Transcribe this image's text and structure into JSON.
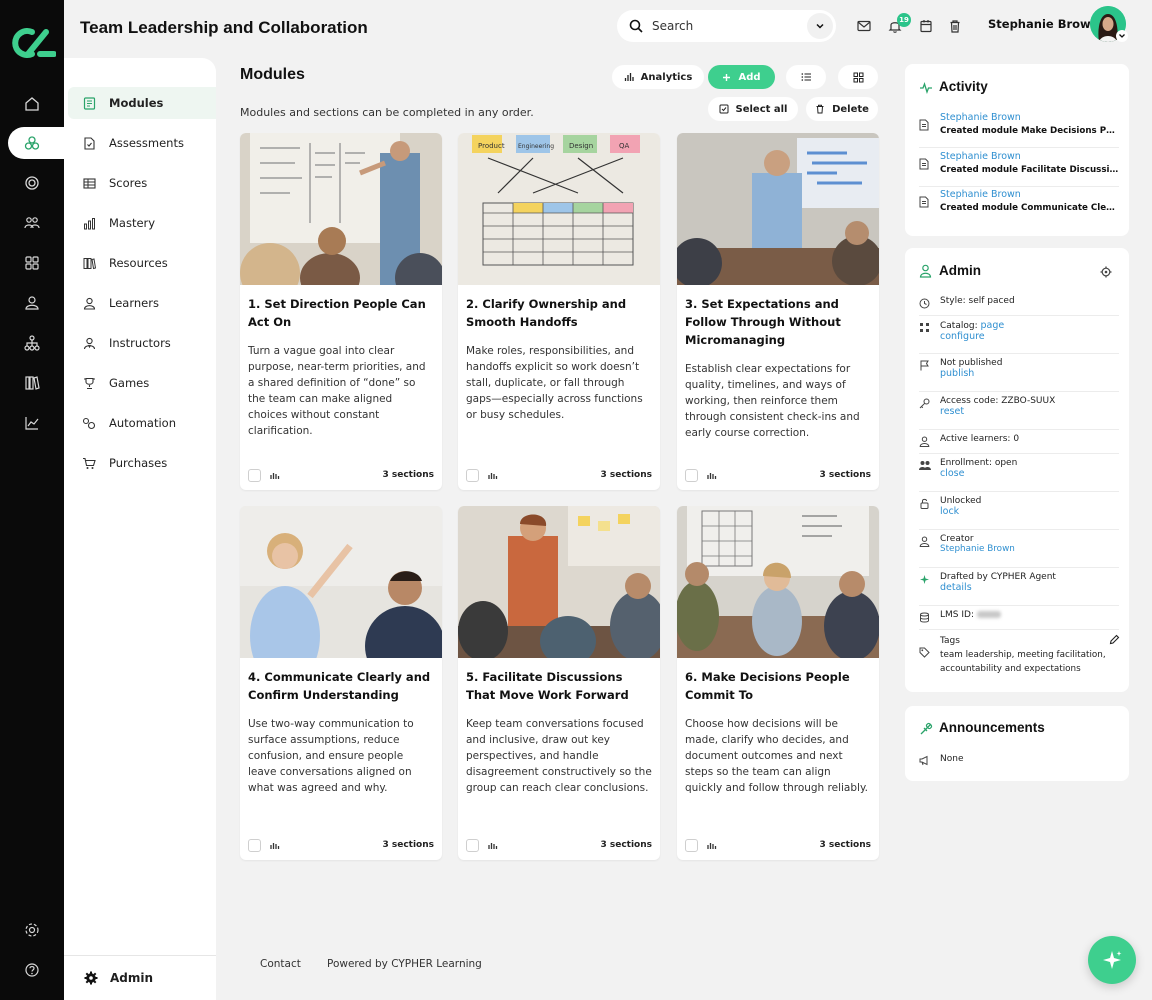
{
  "app": {
    "title": "Team Leadership and Collaboration"
  },
  "header": {
    "search_label": "Search",
    "notification_count": "19",
    "user_name": "Stephanie Brown"
  },
  "submenu": {
    "items": [
      {
        "label": "Modules",
        "icon": "modules-icon"
      },
      {
        "label": "Assessments",
        "icon": "assessments-icon"
      },
      {
        "label": "Scores",
        "icon": "scores-icon"
      },
      {
        "label": "Mastery",
        "icon": "mastery-icon"
      },
      {
        "label": "Resources",
        "icon": "resources-icon"
      },
      {
        "label": "Learners",
        "icon": "learners-icon"
      },
      {
        "label": "Instructors",
        "icon": "instructors-icon"
      },
      {
        "label": "Games",
        "icon": "games-icon"
      },
      {
        "label": "Automation",
        "icon": "automation-icon"
      },
      {
        "label": "Purchases",
        "icon": "purchases-icon"
      }
    ],
    "admin_label": "Admin"
  },
  "modules": {
    "title": "Modules",
    "subtitle": "Modules and sections can be completed in any order.",
    "analytics_label": "Analytics",
    "add_label": "Add",
    "select_all_label": "Select all",
    "delete_label": "Delete"
  },
  "cards": [
    {
      "title": "1. Set Direction People Can Act On",
      "desc": "Turn a vague goal into clear purpose, near-term priorities, and a shared definition of “done” so the team can make aligned choices without constant clarification.",
      "sections": "3 sections"
    },
    {
      "title": "2. Clarify Ownership and Smooth Handoffs",
      "desc": "Make roles, responsibilities, and handoffs explicit so work doesn’t stall, duplicate, or fall through gaps—especially across functions or busy schedules.",
      "sections": "3 sections",
      "sticky": [
        "Product",
        "Engineering",
        "Design",
        "QA"
      ]
    },
    {
      "title": "3. Set Expectations and Follow Through Without Micromanaging",
      "desc": "Establish clear expectations for quality, timelines, and ways of working, then reinforce them through consistent check-ins and early course correction.",
      "sections": "3 sections"
    },
    {
      "title": "4. Communicate Clearly and Confirm Understanding",
      "desc": "Use two-way communication to surface assumptions, reduce confusion, and ensure people leave conversations aligned on what was agreed and why.",
      "sections": "3 sections"
    },
    {
      "title": "5. Facilitate Discussions That Move Work Forward",
      "desc": "Keep team conversations focused and inclusive, draw out key perspectives, and handle disagreement constructively so the group can reach clear conclusions.",
      "sections": "3 sections"
    },
    {
      "title": "6. Make Decisions People Commit To",
      "desc": "Choose how decisions will be made, clarify who decides, and document outcomes and next steps so the team can align quickly and follow through reliably.",
      "sections": "3 sections"
    }
  ],
  "activity": {
    "title": "Activity",
    "items": [
      {
        "who": "Stephanie Brown",
        "what": "Created module Make Decisions People Commit To"
      },
      {
        "who": "Stephanie Brown",
        "what": "Created module Facilitate Discussions That Move Work Forward"
      },
      {
        "who": "Stephanie Brown",
        "what": "Created module Communicate Clearly and Confirm Understanding"
      }
    ]
  },
  "admin": {
    "title": "Admin",
    "style": "Style: self paced",
    "catalog": "Catalog:",
    "catalog_link1": "page",
    "catalog_link2": "configure",
    "published": "Not published",
    "publish_link": "publish",
    "access_code": "Access code: ZZBO-SUUX",
    "reset_link": "reset",
    "active_learners": "Active learners: 0",
    "enrollment": "Enrollment: open",
    "close_link": "close",
    "unlocked": "Unlocked",
    "lock_link": "lock",
    "creator": "Creator",
    "creator_link": "Stephanie Brown",
    "drafted": "Drafted by CYPHER Agent",
    "details_link": "details",
    "lms_id": "LMS ID:",
    "tags_label": "Tags",
    "tags": "team leadership, meeting facilitation, accountability and expectations"
  },
  "announcements": {
    "title": "Announcements",
    "value": "None"
  },
  "footer": {
    "contact": "Contact",
    "powered": "Powered by CYPHER Learning"
  },
  "colors": {
    "accent": "#3ecf8e",
    "link": "#2f8fd0",
    "rail": "#0a0a0a"
  }
}
